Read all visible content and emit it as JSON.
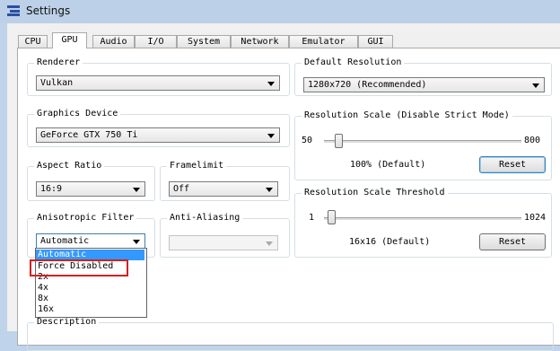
{
  "window": {
    "title": "Settings",
    "icon": "settings-app-icon"
  },
  "tabs": [
    "CPU",
    "GPU",
    "Audio",
    "I/O",
    "System",
    "Network",
    "Emulator",
    "GUI"
  ],
  "active_tab": "GPU",
  "renderer": {
    "label": "Renderer",
    "value": "Vulkan"
  },
  "graphics_device": {
    "label": "Graphics Device",
    "value": "GeForce GTX 750 Ti"
  },
  "aspect_ratio": {
    "label": "Aspect Ratio",
    "value": "16:9"
  },
  "framelimit": {
    "label": "Framelimit",
    "value": "Off"
  },
  "anisotropic": {
    "label": "Anisotropic Filter",
    "value": "Automatic",
    "options": [
      "Automatic",
      "Force Disabled",
      "2x",
      "4x",
      "8x",
      "16x"
    ],
    "highlighted": "Automatic"
  },
  "anti_aliasing": {
    "label": "Anti-Aliasing",
    "value": ""
  },
  "default_resolution": {
    "label": "Default Resolution",
    "value": "1280x720 (Recommended)"
  },
  "resolution_scale": {
    "label": "Resolution Scale (Disable Strict Mode)",
    "min": "50",
    "max": "800",
    "current": 100,
    "status": "100% (Default)",
    "reset": "Reset"
  },
  "resolution_threshold": {
    "label": "Resolution Scale Threshold",
    "min": "1",
    "max": "1024",
    "current": 16,
    "status": "16x16 (Default)",
    "reset": "Reset"
  },
  "description": {
    "label": "Description"
  },
  "colors": {
    "highlight": "#3399ff",
    "annotation_box": "#d42020",
    "title_bar": "#bcd0e8"
  }
}
